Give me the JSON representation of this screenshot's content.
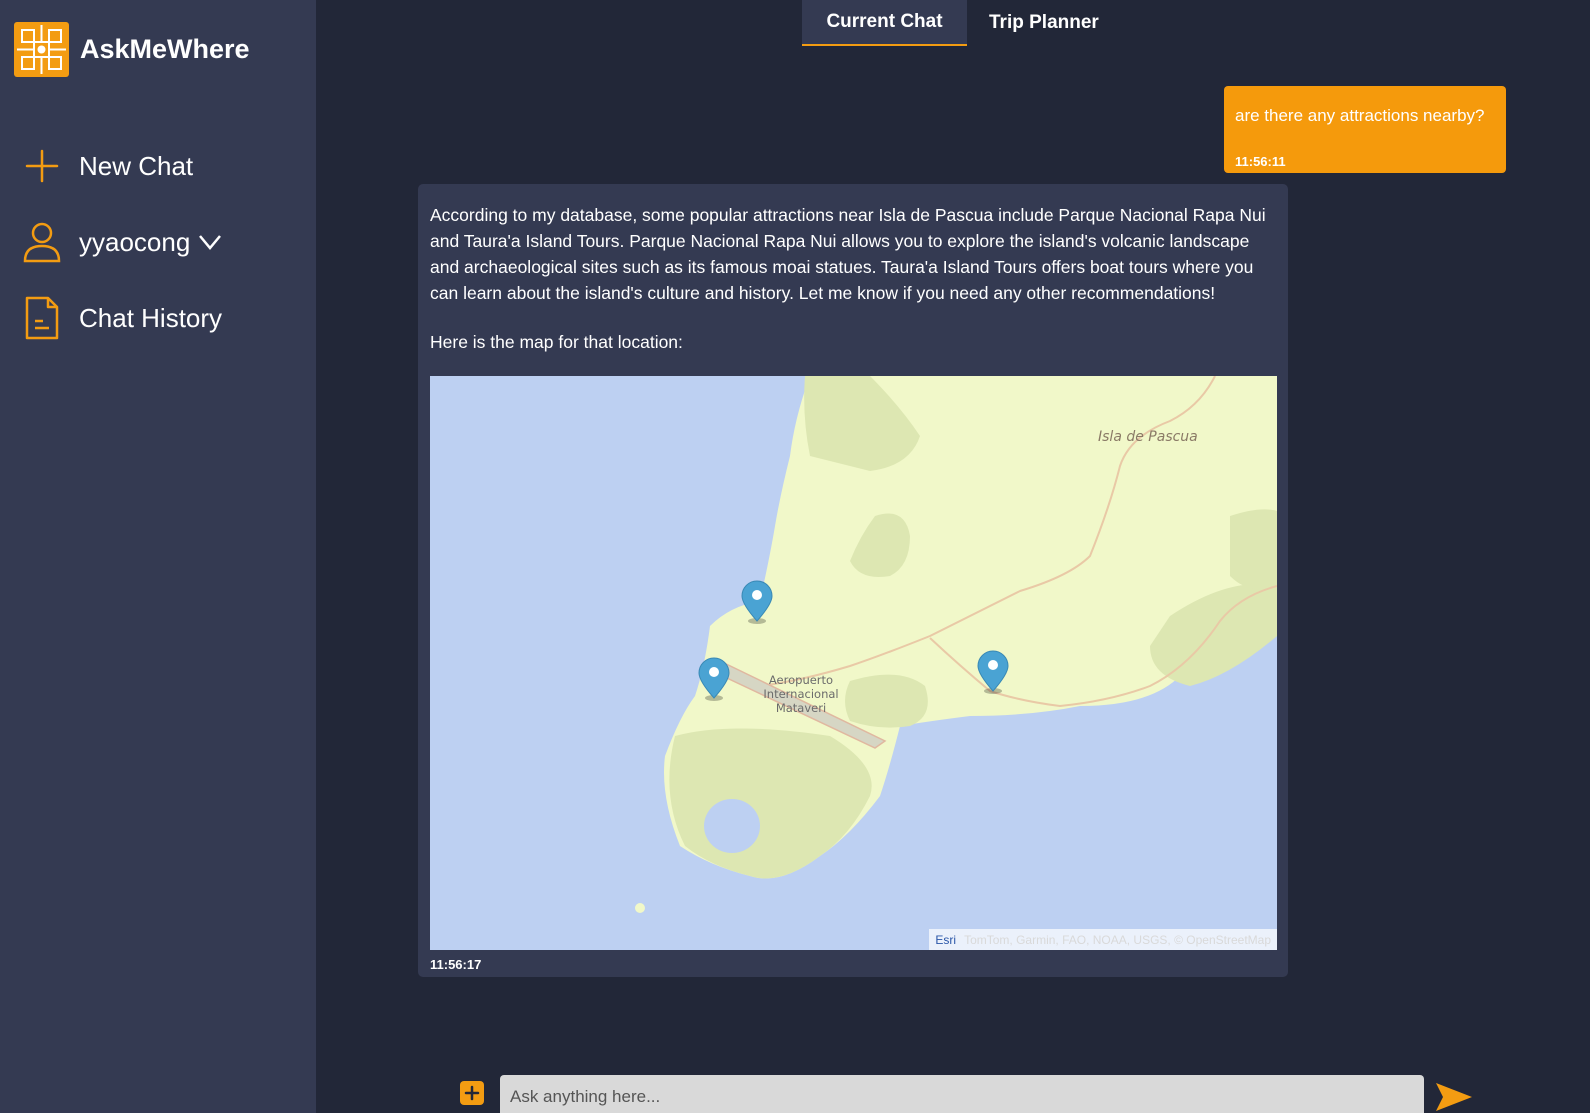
{
  "brand": {
    "name": "AskMeWhere"
  },
  "sidebar": {
    "items": [
      {
        "label": "New Chat",
        "icon": "plus-icon"
      },
      {
        "label": "yyaocong",
        "icon": "user-icon"
      },
      {
        "label": "Chat History",
        "icon": "document-icon"
      }
    ]
  },
  "tabs": [
    {
      "label": "Current Chat",
      "active": true
    },
    {
      "label": "Trip Planner",
      "active": false
    }
  ],
  "messages": {
    "user": {
      "text": "are there any attractions nearby?",
      "time": "11:56:11"
    },
    "bot": {
      "text": "According to my database, some popular attractions near Isla de Pascua include Parque Nacional Rapa Nui and Taura'a Island Tours. Parque Nacional Rapa Nui allows you to explore the island's volcanic landscape and archaeological sites such as its famous moai statues. Taura'a Island Tours offers boat tours where you can learn about the island's culture and history. Let me know if you need any other recommendations!",
      "map_label": "Here is the map for that location:",
      "time": "11:56:17"
    }
  },
  "map": {
    "place_label": "Isla de Pascua",
    "airport_line1": "Aeropuerto",
    "airport_line2": "Internacional",
    "airport_line3": "Mataveri",
    "attribution_brand": "Esri",
    "attribution_text": "TomTom, Garmin, FAO, NOAA, USGS, © OpenStreetMap",
    "water_color": "#bdd0f2",
    "land_color": "#f1f8c9",
    "park_color": "#dde7b2",
    "marker_color": "#4aa3d3"
  },
  "input": {
    "placeholder": "Ask anything here..."
  },
  "colors": {
    "accent": "#f39c12",
    "sidebar": "#343a52",
    "background": "#222738"
  }
}
